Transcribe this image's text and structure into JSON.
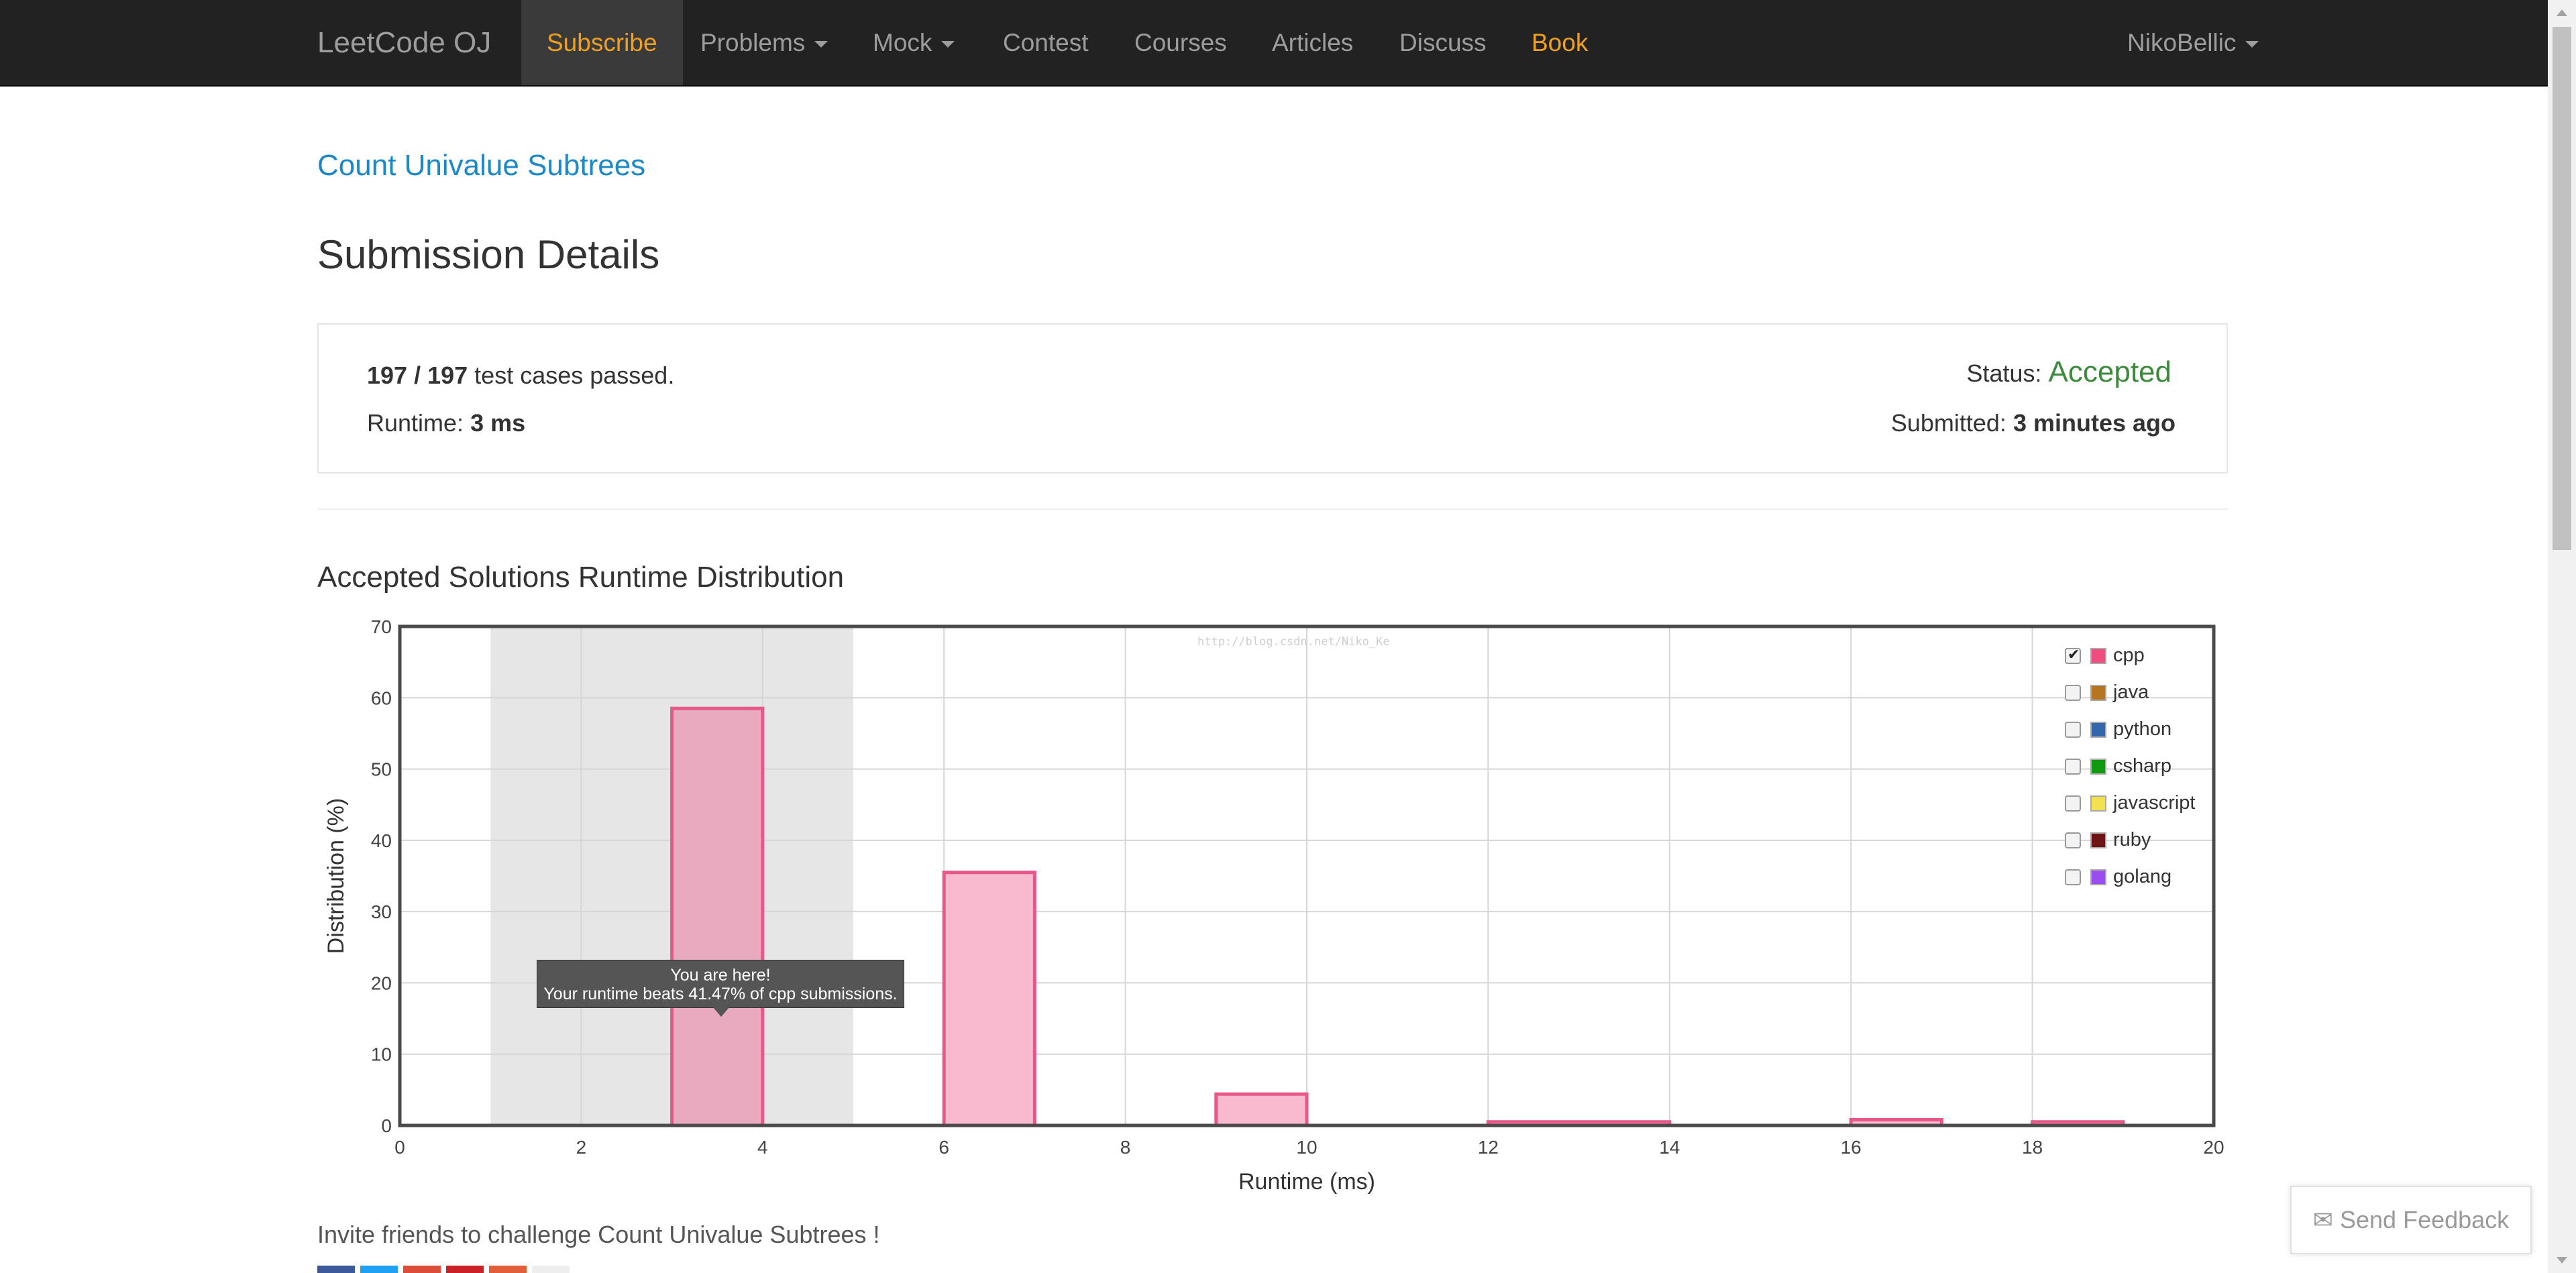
{
  "nav": {
    "brand": "LeetCode OJ",
    "items": [
      {
        "label": "Subscribe",
        "style": "active"
      },
      {
        "label": "Problems",
        "dropdown": true
      },
      {
        "label": "Mock",
        "dropdown": true
      },
      {
        "label": "Contest"
      },
      {
        "label": "Courses"
      },
      {
        "label": "Articles"
      },
      {
        "label": "Discuss"
      },
      {
        "label": "Book",
        "style": "orange"
      }
    ],
    "user": "NikoBellic"
  },
  "problem_link": "Count Univalue Subtrees",
  "page_title": "Submission Details",
  "summary": {
    "passed": "197",
    "sep": " / ",
    "total": "197",
    "passed_suffix": " test cases passed.",
    "runtime_label": "Runtime: ",
    "runtime_value": "3 ms",
    "status_label": "Status: ",
    "status_value": "Accepted",
    "submitted_label": "Submitted: ",
    "submitted_value": "3 minutes ago"
  },
  "chart_heading": "Accepted Solutions Runtime Distribution",
  "watermark": "http://blog.csdn.net/Niko_Ke",
  "chart_data": {
    "type": "bar",
    "title": "Accepted Solutions Runtime Distribution",
    "xlabel": "Runtime (ms)",
    "ylabel": "Distribution (%)",
    "xlim": [
      0,
      20
    ],
    "ylim": [
      0,
      70
    ],
    "xticks": [
      0,
      2,
      4,
      6,
      8,
      10,
      12,
      14,
      16,
      18,
      20
    ],
    "yticks": [
      0,
      10,
      20,
      30,
      40,
      50,
      60,
      70
    ],
    "grid": true,
    "highlight_range": [
      1,
      5
    ],
    "series": [
      {
        "name": "cpp",
        "color": "#f06292",
        "bars": [
          {
            "x0": 3,
            "x1": 4,
            "value": 58.5,
            "current": true
          },
          {
            "x0": 6,
            "x1": 7,
            "value": 35.5
          },
          {
            "x0": 9,
            "x1": 10,
            "value": 4.4
          },
          {
            "x0": 12,
            "x1": 14,
            "value": 0.5
          },
          {
            "x0": 16,
            "x1": 17,
            "value": 0.8
          },
          {
            "x0": 18,
            "x1": 19,
            "value": 0.5
          }
        ]
      }
    ],
    "legend": [
      {
        "name": "cpp",
        "color": "#ef4d7d",
        "checked": true
      },
      {
        "name": "java",
        "color": "#b5761f",
        "checked": false
      },
      {
        "name": "python",
        "color": "#3366aa",
        "checked": false
      },
      {
        "name": "csharp",
        "color": "#119911",
        "checked": false
      },
      {
        "name": "javascript",
        "color": "#f2e050",
        "checked": false
      },
      {
        "name": "ruby",
        "color": "#6e1414",
        "checked": false
      },
      {
        "name": "golang",
        "color": "#9b4cf0",
        "checked": false
      }
    ],
    "legend_position": "top-right",
    "tooltip": {
      "line1": "You are here!",
      "line2": "Your runtime beats 41.47% of cpp submissions."
    }
  },
  "invite": "Invite friends to challenge Count Univalue Subtrees !",
  "feedback": "Send Feedback",
  "share_colors": [
    "#3b5998",
    "#1da1f2",
    "#dd4b39",
    "#cb2027",
    "#e25e3b",
    "#eeeeee"
  ]
}
